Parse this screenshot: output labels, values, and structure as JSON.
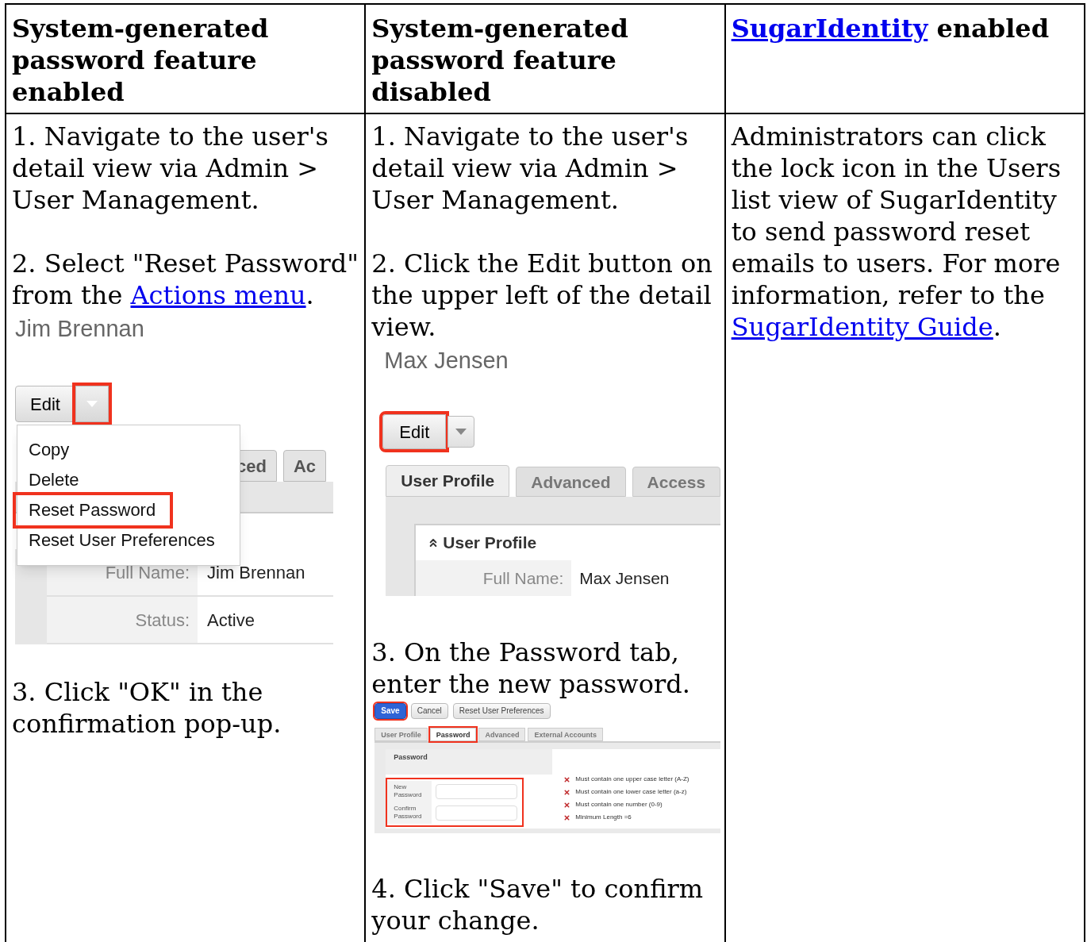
{
  "table": {
    "columns": [
      {
        "heading": [
          {
            "kind": "text",
            "text": "System-generated password feature enabled"
          }
        ]
      },
      {
        "heading": [
          {
            "kind": "text",
            "text": "System-generated password feature disabled"
          }
        ]
      },
      {
        "heading": [
          {
            "kind": "link",
            "text": "SugarIdentity"
          },
          {
            "kind": "text",
            "text": " enabled"
          }
        ]
      }
    ],
    "cells": [
      [
        {
          "kind": "paragraph",
          "parts": [
            {
              "kind": "text",
              "text": "1. Navigate to the user's detail view via Admin > User Management."
            }
          ]
        },
        {
          "kind": "paragraph",
          "parts": [
            {
              "kind": "text",
              "text": "2. Select \"Reset Password\" from the "
            },
            {
              "kind": "link",
              "text": "Actions menu"
            },
            {
              "kind": "text",
              "text": "."
            }
          ]
        },
        {
          "kind": "menu_shot",
          "title": "Jim Brennan",
          "edit_label": "Edit",
          "caret_highlighted": true,
          "menu": [
            {
              "label": "Copy",
              "highlighted": false
            },
            {
              "label": "Delete",
              "highlighted": false
            },
            {
              "label": "Reset Password",
              "highlighted": true
            },
            {
              "label": "Reset User Preferences",
              "highlighted": false
            }
          ],
          "tabs": [
            "ced",
            "Ac"
          ],
          "fields": [
            {
              "label": "Full Name:",
              "value": "Jim Brennan"
            },
            {
              "label": "Status:",
              "value": "Active"
            }
          ]
        },
        {
          "kind": "paragraph",
          "parts": [
            {
              "kind": "text",
              "text": "3. Click \"OK\" in the confirmation pop-up."
            }
          ]
        }
      ],
      [
        {
          "kind": "paragraph",
          "parts": [
            {
              "kind": "text",
              "text": "1. Navigate to the user's detail view via Admin > User Management."
            }
          ]
        },
        {
          "kind": "paragraph",
          "parts": [
            {
              "kind": "text",
              "text": "2. Click the Edit button on the upper left of the detail view."
            }
          ]
        },
        {
          "kind": "edit_shot",
          "title": "Max Jensen",
          "edit_label": "Edit",
          "edit_highlighted": true,
          "tabs": [
            {
              "label": "User Profile",
              "selected": true
            },
            {
              "label": "Advanced",
              "selected": false
            },
            {
              "label": "Access",
              "selected": false
            }
          ],
          "panel_title": "User Profile",
          "fields": [
            {
              "label": "Full Name:",
              "value": "Max Jensen"
            }
          ]
        },
        {
          "kind": "paragraph",
          "parts": [
            {
              "kind": "text",
              "text": "3. On the Password tab, enter the new password."
            }
          ]
        },
        {
          "kind": "password_shot",
          "buttons": [
            {
              "label": "Save",
              "primary": true,
              "highlighted": true
            },
            {
              "label": "Cancel",
              "primary": false,
              "highlighted": false
            },
            {
              "label": "Reset User Preferences",
              "primary": false,
              "highlighted": false
            }
          ],
          "tabs": [
            {
              "label": "User Profile",
              "selected": false
            },
            {
              "label": "Password",
              "selected": true
            },
            {
              "label": "Advanced",
              "selected": false
            },
            {
              "label": "External Accounts",
              "selected": false
            }
          ],
          "panel_title": "Password",
          "fields": [
            {
              "label": "New Password"
            },
            {
              "label": "Confirm Password"
            }
          ],
          "rules": [
            "Must contain one upper case letter (A-Z)",
            "Must contain one lower case letter (a-z)",
            "Must contain one number (0-9)",
            "Minimum Length =6"
          ]
        },
        {
          "kind": "paragraph",
          "parts": [
            {
              "kind": "text",
              "text": "4. Click \"Save\" to confirm your change."
            }
          ]
        }
      ],
      [
        {
          "kind": "paragraph",
          "parts": [
            {
              "kind": "text",
              "text": "Administrators can click the lock icon in the Users list view of SugarIdentity to send password reset emails to users. For more information, refer to the "
            },
            {
              "kind": "link",
              "text": "SugarIdentity Guide"
            },
            {
              "kind": "text",
              "text": "."
            }
          ]
        }
      ]
    ]
  }
}
